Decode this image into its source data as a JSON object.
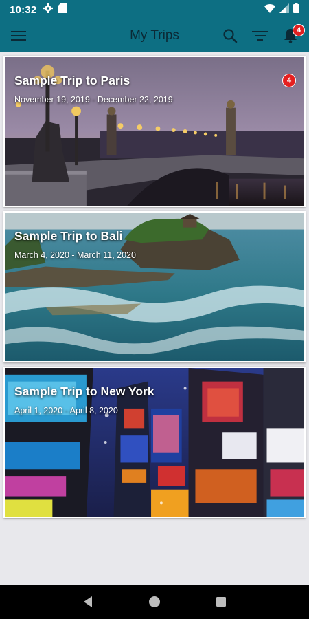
{
  "status_bar": {
    "time": "10:32",
    "icons": [
      "gear-icon",
      "sd-card-icon",
      "wifi-icon",
      "signal-icon",
      "battery-icon"
    ]
  },
  "app_bar": {
    "title": "My Trips",
    "notification_count": "4"
  },
  "trips": [
    {
      "title": "Sample Trip to Paris",
      "dates": "November 19, 2019 - December 22, 2019",
      "badge": "4"
    },
    {
      "title": "Sample Trip to Bali",
      "dates": "March 4, 2020 - March 11, 2020"
    },
    {
      "title": "Sample Trip to New York",
      "dates": "April 1, 2020 - April 8, 2020"
    }
  ],
  "colors": {
    "app_bar": "#0d6f83",
    "title_text": "#0b2a36",
    "badge": "#e02020",
    "background": "#e8e8ec",
    "nav_bar": "#000000"
  }
}
